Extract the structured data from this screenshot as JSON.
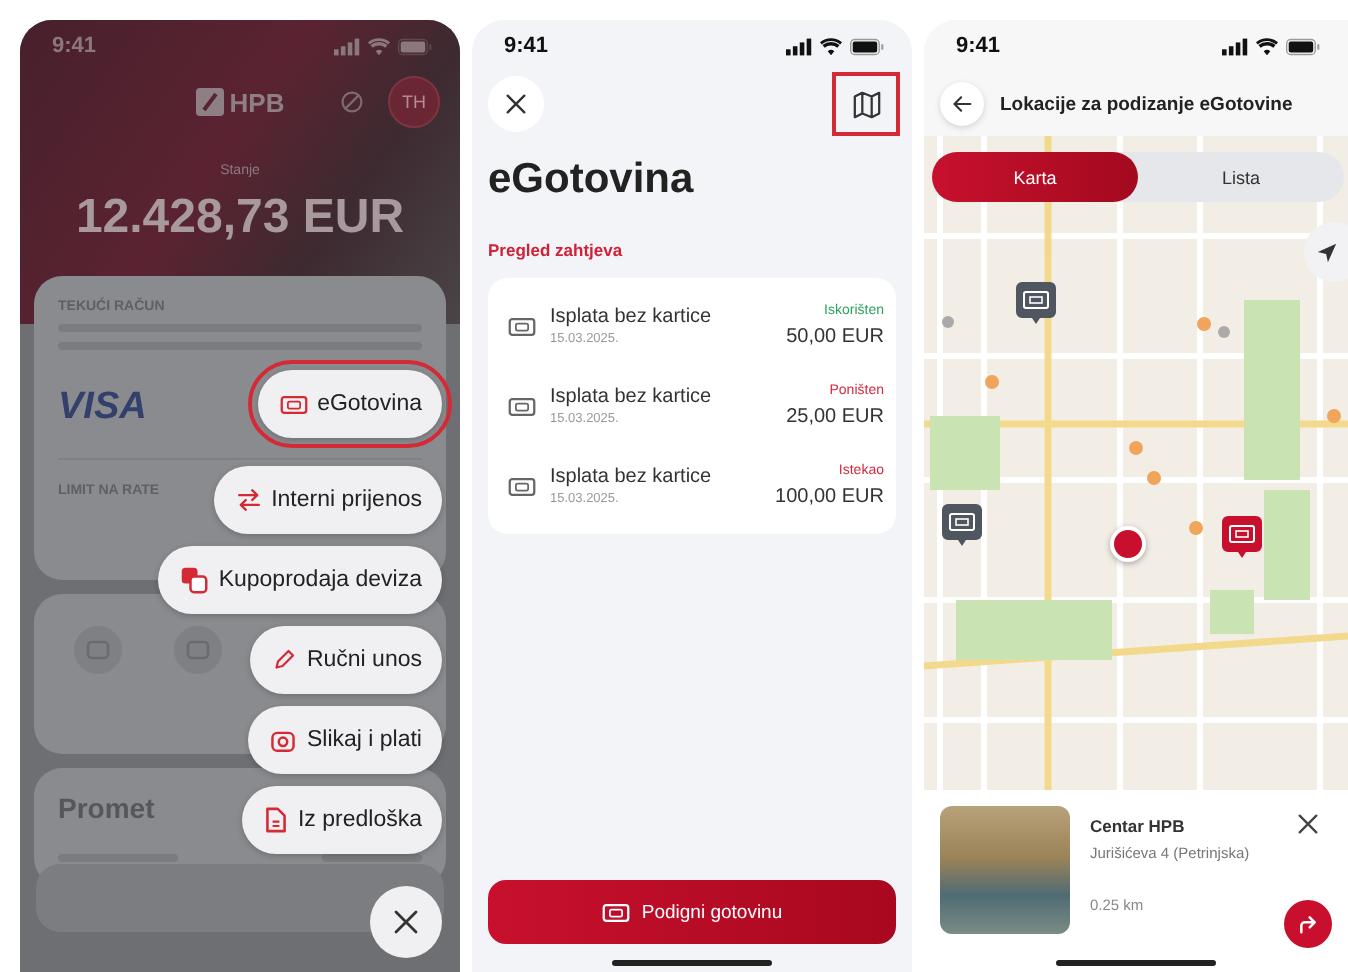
{
  "home_screen": {
    "status_time": "9:41",
    "logo": "HPB",
    "avatar": "TH",
    "balance_label": "Stanje",
    "balance": "12.428,73 EUR",
    "account_label": "TEKUĆI RAČUN",
    "card_brand": "VISA",
    "limit_label": "LIMIT NA RATE",
    "section_title": "Promet",
    "action_menu": [
      {
        "label": "eGotovina",
        "kind": "cash",
        "highlighted": true
      },
      {
        "label": "Interni prijenos",
        "kind": "transfer",
        "highlighted": false
      },
      {
        "label": "Kupoprodaja deviza",
        "kind": "exchange",
        "highlighted": false
      },
      {
        "label": "Ručni unos",
        "kind": "pencil",
        "highlighted": false
      },
      {
        "label": "Slikaj i plati",
        "kind": "camera",
        "highlighted": false
      },
      {
        "label": "Iz predloška",
        "kind": "document",
        "highlighted": false
      }
    ]
  },
  "egotovina_screen": {
    "status_time": "9:41",
    "map_button": {
      "highlighted": true
    },
    "title": "eGotovina",
    "section_title": "Pregled zahtjeva",
    "requests": [
      {
        "title": "Isplata bez kartice",
        "date": "15.03.2025.",
        "status": "Iskorišten",
        "color": "#2ca25f",
        "amount": "50,00 EUR"
      },
      {
        "title": "Isplata bez kartice",
        "date": "15.03.2025.",
        "status": "Poništen",
        "color": "#d6293e",
        "amount": "25,00 EUR"
      },
      {
        "title": "Isplata bez kartice",
        "date": "15.03.2025.",
        "status": "Istekao",
        "color": "#d6293e",
        "amount": "100,00 EUR"
      }
    ],
    "primary_button": "Podigni gotovinu"
  },
  "map_screen": {
    "status_time": "9:41",
    "title": "Lokacije za podizanje eGotovine",
    "view_tabs": [
      {
        "label": "Karta",
        "selected": true
      },
      {
        "label": "Lista",
        "selected": false
      }
    ],
    "pins": [
      {
        "selected": false
      },
      {
        "selected": false
      },
      {
        "selected": true
      }
    ],
    "location": {
      "name": "Centar HPB",
      "address": "Jurišićeva 4 (Petrinjska)",
      "distance": "0.25 km"
    }
  }
}
